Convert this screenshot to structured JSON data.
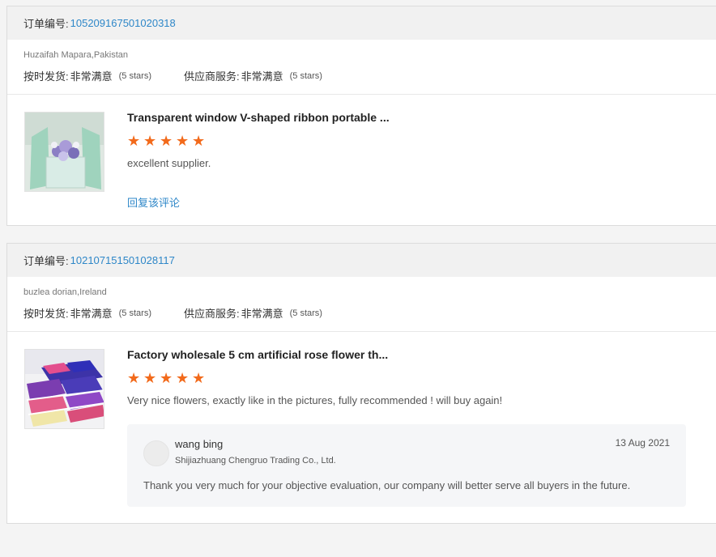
{
  "labels": {
    "order_label": "订单编号:",
    "ontime_label": "按时发货:",
    "service_label": "供应商服务:",
    "reply_link": "回复该评论"
  },
  "colors": {
    "link": "#2e87c8",
    "star": "#f26a1b",
    "header_bg": "#f1f1f1"
  },
  "reviews": [
    {
      "order_no": "105209167501020318",
      "buyer": "Huzaifah Mapara,Pakistan",
      "ontime_value": "非常满意",
      "ontime_stars": "(5 stars)",
      "service_value": "非常满意",
      "service_stars": "(5 stars)",
      "product_title": "Transparent window V-shaped ribbon portable ...",
      "rating": 5,
      "text": "excellent supplier."
    },
    {
      "order_no": "102107151501028117",
      "buyer": "buzlea dorian,Ireland",
      "ontime_value": "非常满意",
      "ontime_stars": "(5 stars)",
      "service_value": "非常满意",
      "service_stars": "(5 stars)",
      "product_title": "Factory wholesale 5 cm artificial rose flower th...",
      "rating": 5,
      "text": "Very nice flowers, exactly like in the pictures, fully recommended ! will buy again!",
      "seller_reply": {
        "name": "wang bing",
        "company": "Shijiazhuang Chengruo Trading Co., Ltd.",
        "date": "13 Aug 2021",
        "text": "Thank you very much for your objective evaluation, our company will better serve all buyers in the future."
      }
    }
  ]
}
